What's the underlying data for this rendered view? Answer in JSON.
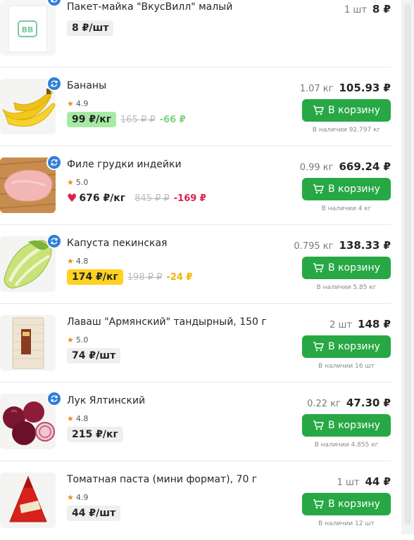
{
  "products": [
    {
      "name": "Пакет-майка \"ВкусВилл\" малый",
      "rating": "",
      "price": "8 ₽/шт",
      "price_style": "plain-grey",
      "old_price": "",
      "discount": "",
      "discount_color": "",
      "qty": "1 шт",
      "total": "8 ₽",
      "button": "",
      "stock": "",
      "heart": false,
      "cut_top": true
    },
    {
      "name": "Бананы",
      "rating": "4.9",
      "price": "99 ₽/кг",
      "price_style": "green",
      "old_price": "165 ₽ ₽",
      "discount": "-66 ₽",
      "discount_color": "#7ad67a",
      "qty": "1.07 кг",
      "total": "105.93 ₽",
      "button": "В корзину",
      "stock": "В наличии 92.797 кг",
      "heart": false
    },
    {
      "name": "Филе грудки индейки",
      "rating": "5.0",
      "price": "676 ₽/кг",
      "price_style": "plain",
      "old_price": "845 ₽ ₽",
      "discount": "-169 ₽",
      "discount_color": "#e21d4e",
      "qty": "0.99 кг",
      "total": "669.24 ₽",
      "button": "В корзину",
      "stock": "В наличии 4 кг",
      "heart": true
    },
    {
      "name": "Капуста пекинская",
      "rating": "4.8",
      "price": "174 ₽/кг",
      "price_style": "yellow",
      "old_price": "198 ₽ ₽",
      "discount": "-24 ₽",
      "discount_color": "#f0b400",
      "qty": "0.795 кг",
      "total": "138.33 ₽",
      "button": "В корзину",
      "stock": "В наличии 5.85 кг",
      "heart": false
    },
    {
      "name": "Лаваш \"Армянский\" тандырный, 150 г",
      "rating": "5.0",
      "price": "74 ₽/шт",
      "price_style": "grey",
      "old_price": "",
      "discount": "",
      "discount_color": "",
      "qty": "2 шт",
      "total": "148 ₽",
      "button": "В корзину",
      "stock": "В наличии 16 шт",
      "heart": false
    },
    {
      "name": "Лук Ялтинский",
      "rating": "4.8",
      "price": "215 ₽/кг",
      "price_style": "grey",
      "old_price": "",
      "discount": "",
      "discount_color": "",
      "qty": "0.22 кг",
      "total": "47.30 ₽",
      "button": "В корзину",
      "stock": "В наличии 4.855 кг",
      "heart": false
    },
    {
      "name": "Томатная паста (мини формат), 70 г",
      "rating": "4.9",
      "price": "44 ₽/шт",
      "price_style": "grey",
      "old_price": "",
      "discount": "",
      "discount_color": "",
      "qty": "1 шт",
      "total": "44 ₽",
      "button": "В корзину",
      "stock": "В наличии 12 шт",
      "heart": false
    }
  ],
  "icons": {
    "badge": "refresh-icon",
    "star": "star-icon",
    "cart": "cart-icon",
    "heart": "heart-icon"
  },
  "colors": {
    "accent": "#27a844",
    "badge": "#2f7fd8",
    "star": "#f08a1e"
  }
}
